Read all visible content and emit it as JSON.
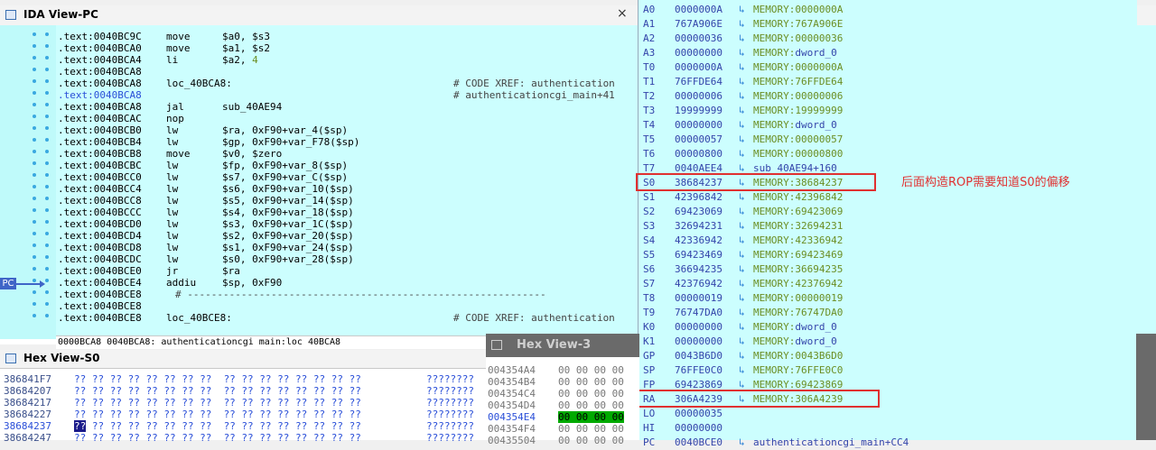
{
  "ida": {
    "title": "IDA View-PC",
    "close": "×",
    "pc_badge": "PC",
    "status": "0000BCA8 0040BCA8: authenticationcgi main:loc 40BCA8",
    "lines": [
      {
        "addr": ".text:0040BC9C",
        "mn": "move",
        "op": "$a0, $s3",
        "num": "",
        "cmt": ""
      },
      {
        "addr": ".text:0040BCA0",
        "mn": "move",
        "op": "$a1, $s2",
        "num": "",
        "cmt": ""
      },
      {
        "addr": ".text:0040BCA4",
        "mn": "li",
        "op": "$a2, ",
        "num": "4",
        "cmt": ""
      },
      {
        "addr": ".text:0040BCA8",
        "mn": "",
        "op": "",
        "num": "",
        "cmt": ""
      },
      {
        "addr": ".text:0040BCA8",
        "mn": "loc_40BCA8:",
        "op": "",
        "num": "",
        "cmt": "# CODE XREF: authentication"
      },
      {
        "addr": ".text:0040BCA8",
        "mn": "",
        "op": "",
        "num": "",
        "cmt": "# authenticationcgi_main+41"
      },
      {
        "addr": ".text:0040BCA8",
        "mn": "jal",
        "op": "sub_40AE94",
        "num": "",
        "cmt": ""
      },
      {
        "addr": ".text:0040BCAC",
        "mn": "nop",
        "op": "",
        "num": "",
        "cmt": ""
      },
      {
        "addr": ".text:0040BCB0",
        "mn": "lw",
        "op": "$ra, 0xF90+var_4($sp)",
        "num": "",
        "cmt": ""
      },
      {
        "addr": ".text:0040BCB4",
        "mn": "lw",
        "op": "$gp, 0xF90+var_F78($sp)",
        "num": "",
        "cmt": ""
      },
      {
        "addr": ".text:0040BCB8",
        "mn": "move",
        "op": "$v0, $zero",
        "num": "",
        "cmt": ""
      },
      {
        "addr": ".text:0040BCBC",
        "mn": "lw",
        "op": "$fp, 0xF90+var_8($sp)",
        "num": "",
        "cmt": ""
      },
      {
        "addr": ".text:0040BCC0",
        "mn": "lw",
        "op": "$s7, 0xF90+var_C($sp)",
        "num": "",
        "cmt": ""
      },
      {
        "addr": ".text:0040BCC4",
        "mn": "lw",
        "op": "$s6, 0xF90+var_10($sp)",
        "num": "",
        "cmt": ""
      },
      {
        "addr": ".text:0040BCC8",
        "mn": "lw",
        "op": "$s5, 0xF90+var_14($sp)",
        "num": "",
        "cmt": ""
      },
      {
        "addr": ".text:0040BCCC",
        "mn": "lw",
        "op": "$s4, 0xF90+var_18($sp)",
        "num": "",
        "cmt": ""
      },
      {
        "addr": ".text:0040BCD0",
        "mn": "lw",
        "op": "$s3, 0xF90+var_1C($sp)",
        "num": "",
        "cmt": ""
      },
      {
        "addr": ".text:0040BCD4",
        "mn": "lw",
        "op": "$s2, 0xF90+var_20($sp)",
        "num": "",
        "cmt": ""
      },
      {
        "addr": ".text:0040BCD8",
        "mn": "lw",
        "op": "$s1, 0xF90+var_24($sp)",
        "num": "",
        "cmt": ""
      },
      {
        "addr": ".text:0040BCDC",
        "mn": "lw",
        "op": "$s0, 0xF90+var_28($sp)",
        "num": "",
        "cmt": ""
      },
      {
        "addr": ".text:0040BCE0",
        "mn": "jr",
        "op": "$ra",
        "num": "",
        "cmt": ""
      },
      {
        "addr": ".text:0040BCE4",
        "mn": "addiu",
        "op": "$sp, 0xF90",
        "num": "",
        "cmt": ""
      },
      {
        "addr": ".text:0040BCE8",
        "mn": "# ------------------------------------------------------------",
        "op": "",
        "num": "",
        "cmt": ""
      },
      {
        "addr": ".text:0040BCE8",
        "mn": "",
        "op": "",
        "num": "",
        "cmt": ""
      },
      {
        "addr": ".text:0040BCE8",
        "mn": "loc_40BCE8:",
        "op": "",
        "num": "",
        "cmt": "# CODE XREF: authentication"
      }
    ]
  },
  "registers": {
    "annotation": "后面构造ROP需要知道S0的偏移",
    "rows": [
      {
        "name": "A0",
        "val": "0000000A",
        "arrow": "↳",
        "prefix": "MEMORY:",
        "target": "0000000A"
      },
      {
        "name": "A1",
        "val": "767A906E",
        "arrow": "↳",
        "prefix": "MEMORY:",
        "target": "767A906E"
      },
      {
        "name": "A2",
        "val": "00000036",
        "arrow": "↳",
        "prefix": "MEMORY:",
        "target": "00000036"
      },
      {
        "name": "A3",
        "val": "00000000",
        "arrow": "↳",
        "prefix": "MEMORY:",
        "target": "dword_0"
      },
      {
        "name": "T0",
        "val": "0000000A",
        "arrow": "↳",
        "prefix": "MEMORY:",
        "target": "0000000A"
      },
      {
        "name": "T1",
        "val": "76FFDE64",
        "arrow": "↳",
        "prefix": "MEMORY:",
        "target": "76FFDE64"
      },
      {
        "name": "T2",
        "val": "00000006",
        "arrow": "↳",
        "prefix": "MEMORY:",
        "target": "00000006"
      },
      {
        "name": "T3",
        "val": "19999999",
        "arrow": "↳",
        "prefix": "MEMORY:",
        "target": "19999999"
      },
      {
        "name": "T4",
        "val": "00000000",
        "arrow": "↳",
        "prefix": "MEMORY:",
        "target": "dword_0"
      },
      {
        "name": "T5",
        "val": "00000057",
        "arrow": "↳",
        "prefix": "MEMORY:",
        "target": "00000057"
      },
      {
        "name": "T6",
        "val": "00000800",
        "arrow": "↳",
        "prefix": "MEMORY:",
        "target": "00000800"
      },
      {
        "name": "T7",
        "val": "0040AEE4",
        "arrow": "↳",
        "prefix": "",
        "target": "sub_40AE94+160"
      },
      {
        "name": "S0",
        "val": "38684237",
        "arrow": "↳",
        "prefix": "MEMORY:",
        "target": "38684237"
      },
      {
        "name": "S1",
        "val": "42396842",
        "arrow": "↳",
        "prefix": "MEMORY:",
        "target": "42396842"
      },
      {
        "name": "S2",
        "val": "69423069",
        "arrow": "↳",
        "prefix": "MEMORY:",
        "target": "69423069"
      },
      {
        "name": "S3",
        "val": "32694231",
        "arrow": "↳",
        "prefix": "MEMORY:",
        "target": "32694231"
      },
      {
        "name": "S4",
        "val": "42336942",
        "arrow": "↳",
        "prefix": "MEMORY:",
        "target": "42336942"
      },
      {
        "name": "S5",
        "val": "69423469",
        "arrow": "↳",
        "prefix": "MEMORY:",
        "target": "69423469"
      },
      {
        "name": "S6",
        "val": "36694235",
        "arrow": "↳",
        "prefix": "MEMORY:",
        "target": "36694235"
      },
      {
        "name": "S7",
        "val": "42376942",
        "arrow": "↳",
        "prefix": "MEMORY:",
        "target": "42376942"
      },
      {
        "name": "T8",
        "val": "00000019",
        "arrow": "↳",
        "prefix": "MEMORY:",
        "target": "00000019"
      },
      {
        "name": "T9",
        "val": "76747DA0",
        "arrow": "↳",
        "prefix": "MEMORY:",
        "target": "76747DA0"
      },
      {
        "name": "K0",
        "val": "00000000",
        "arrow": "↳",
        "prefix": "MEMORY:",
        "target": "dword_0"
      },
      {
        "name": "K1",
        "val": "00000000",
        "arrow": "↳",
        "prefix": "MEMORY:",
        "target": "dword_0"
      },
      {
        "name": "GP",
        "val": "0043B6D0",
        "arrow": "↳",
        "prefix": "MEMORY:",
        "target": "0043B6D0"
      },
      {
        "name": "SP",
        "val": "76FFE0C0",
        "arrow": "↳",
        "prefix": "MEMORY:",
        "target": "76FFE0C0"
      },
      {
        "name": "FP",
        "val": "69423869",
        "arrow": "↳",
        "prefix": "MEMORY:",
        "target": "69423869"
      },
      {
        "name": "RA",
        "val": "306A4239",
        "arrow": "↳",
        "prefix": "MEMORY:",
        "target": "306A4239"
      },
      {
        "name": "LO",
        "val": "00000035",
        "arrow": "",
        "prefix": "",
        "target": ""
      },
      {
        "name": "HI",
        "val": "00000000",
        "arrow": "",
        "prefix": "",
        "target": ""
      },
      {
        "name": "PC",
        "val": "0040BCE0",
        "arrow": "↳",
        "prefix": "",
        "target": "authenticationcgi_main+CC4"
      }
    ]
  },
  "hex_s0": {
    "title": "Hex View-S0",
    "rows": [
      {
        "addr": "386841F7",
        "sel": "",
        "bytes": "?? ?? ?? ?? ?? ?? ?? ??  ?? ?? ?? ?? ?? ?? ?? ??",
        "ascii": "????????"
      },
      {
        "addr": "38684207",
        "sel": "",
        "bytes": "?? ?? ?? ?? ?? ?? ?? ??  ?? ?? ?? ?? ?? ?? ?? ??",
        "ascii": "????????"
      },
      {
        "addr": "38684217",
        "sel": "",
        "bytes": "?? ?? ?? ?? ?? ?? ?? ??  ?? ?? ?? ?? ?? ?? ?? ??",
        "ascii": "????????"
      },
      {
        "addr": "38684227",
        "sel": "",
        "bytes": "?? ?? ?? ?? ?? ?? ?? ??  ?? ?? ?? ?? ?? ?? ?? ??",
        "ascii": "????????"
      },
      {
        "addr": "38684237",
        "sel": "??",
        "bytes": " ?? ?? ?? ?? ?? ?? ??  ?? ?? ?? ?? ?? ?? ?? ??",
        "ascii": "????????"
      },
      {
        "addr": "38684247",
        "sel": "",
        "bytes": "?? ?? ?? ?? ?? ?? ?? ??  ?? ?? ?? ?? ?? ?? ?? ??",
        "ascii": "????????"
      }
    ]
  },
  "hex_3": {
    "title": "Hex View-3",
    "rows": [
      {
        "addr": "004354A4",
        "bytes": "00 00 00 00",
        "sel": false
      },
      {
        "addr": "004354B4",
        "bytes": "00 00 00 00",
        "sel": false
      },
      {
        "addr": "004354C4",
        "bytes": "00 00 00 00",
        "sel": false
      },
      {
        "addr": "004354D4",
        "bytes": "00 00 00 00",
        "sel": false
      },
      {
        "addr": "004354E4",
        "bytes": "00 00 00 00",
        "sel": true
      },
      {
        "addr": "004354F4",
        "bytes": "00 00 00 00",
        "sel": false
      },
      {
        "addr": "00435504",
        "bytes": "00 00 00 00",
        "sel": false
      }
    ]
  }
}
